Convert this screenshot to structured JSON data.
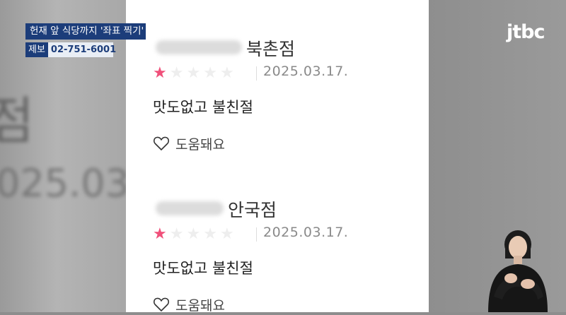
{
  "background": {
    "zoomed_char": "점",
    "zoomed_date": "025.03"
  },
  "reviews": [
    {
      "branch": "북촌점",
      "rating": 1,
      "max_rating": 5,
      "date": "2025.03.17.",
      "text": "맛도없고 불친절",
      "help_label": "도움돼요"
    },
    {
      "branch": "안국점",
      "rating": 1,
      "max_rating": 5,
      "date": "2025.03.17.",
      "text": "맛도없고 불친절",
      "help_label": "도움돼요"
    }
  ],
  "caption": {
    "headline": "헌재 앞 식당까지 '좌표 찍기'",
    "tip_label": "제보",
    "tip_number": "02-751-6001"
  },
  "broadcaster": {
    "logo": "jtbc"
  },
  "colors": {
    "star_active": "#f0507a",
    "star_inactive": "#eeeeee",
    "caption_bg": "#1c3d7a"
  },
  "icons": {
    "help": "heart-outline-icon"
  }
}
